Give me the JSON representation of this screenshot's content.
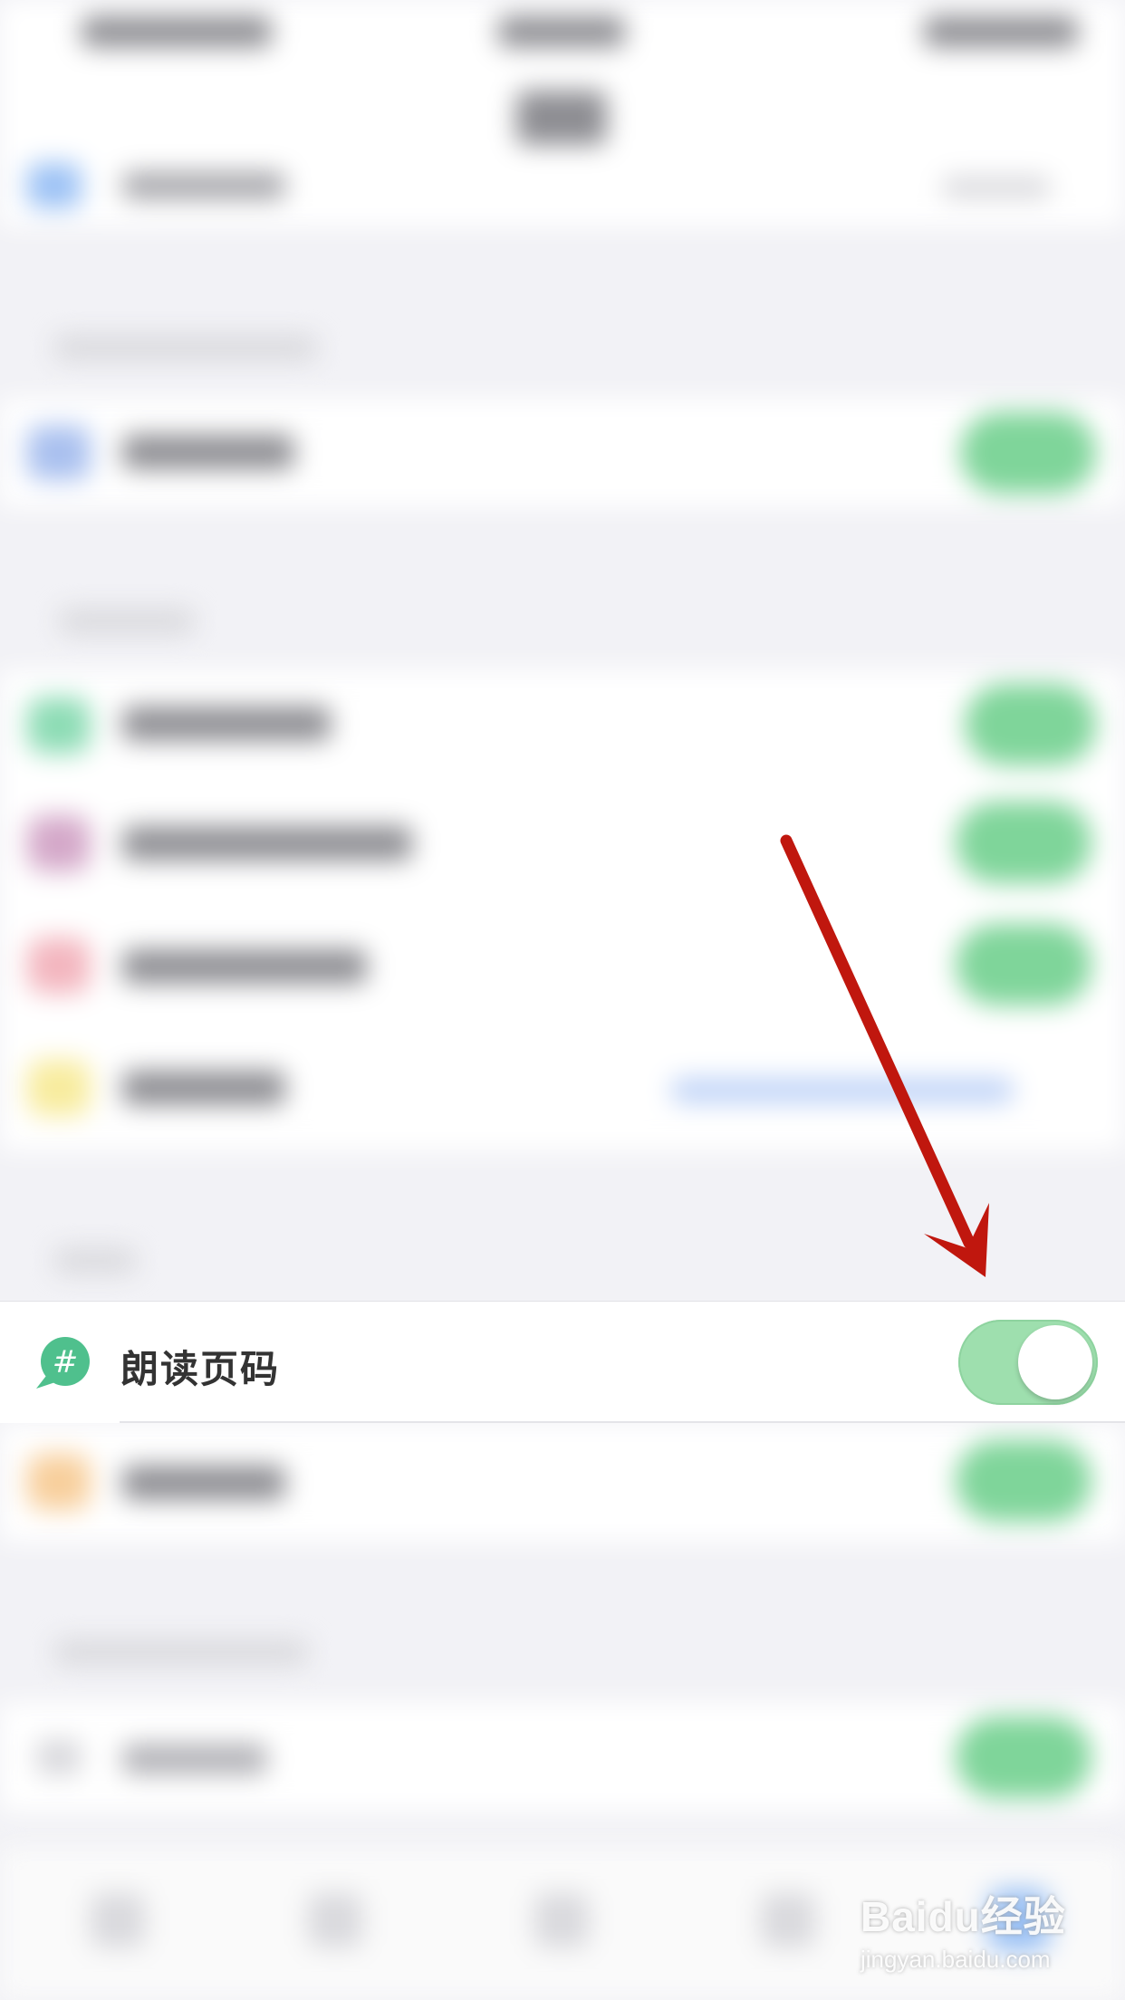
{
  "settings": {
    "focused_item": {
      "label": "朗读页码",
      "icon": "hash-speech-bubble-icon",
      "toggle_state": "on",
      "colors": {
        "icon_green": "#4fc08d",
        "toggle_on": "#9edfae"
      }
    }
  },
  "annotation": {
    "arrow_color": "#c0170e"
  },
  "watermark": {
    "brand": "Baidu经验",
    "url": "jingyan.baidu.com"
  }
}
